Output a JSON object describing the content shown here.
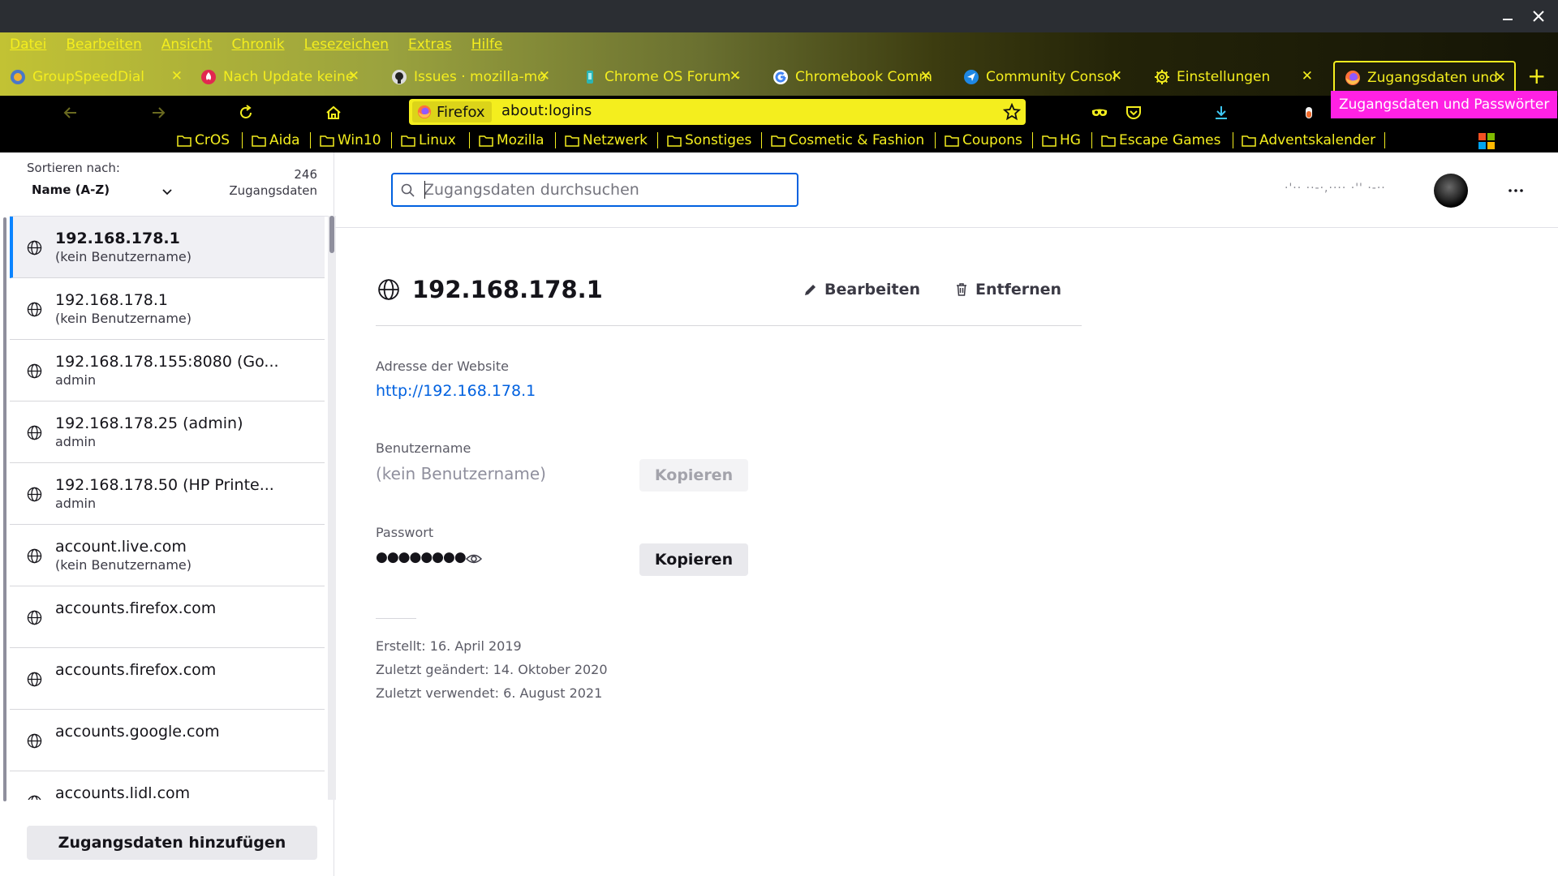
{
  "colors": {
    "accent_yellow": "#f4ee1e",
    "tooltip_magenta": "#ff21e4",
    "link_blue": "#0061e0",
    "selection_blue": "#0a84ff"
  },
  "menubar": [
    "Datei",
    "Bearbeiten",
    "Ansicht",
    "Chronik",
    "Lesezeichen",
    "Extras",
    "Hilfe"
  ],
  "tabs": [
    {
      "title": "GroupSpeedDial",
      "icon": "speed-dial-icon"
    },
    {
      "title": "Nach Update keine",
      "icon": "mozilla-support-icon"
    },
    {
      "title": "Issues · mozilla-mo",
      "icon": "github-icon"
    },
    {
      "title": "Chrome OS Forum -",
      "icon": "forum-icon"
    },
    {
      "title": "Chromebook Comm",
      "icon": "google-icon"
    },
    {
      "title": "Community Consol",
      "icon": "community-console-icon"
    },
    {
      "title": "Einstellungen",
      "icon": "gear-icon"
    },
    {
      "title": "Zugangsdaten und",
      "icon": "firefox-icon",
      "active": true
    }
  ],
  "urlbar": {
    "identity": "Firefox",
    "url": "about:logins"
  },
  "tooltip": "Zugangsdaten und Passwörter",
  "bookmarks": [
    "CrOS",
    "Aida",
    "Win10",
    "Linux",
    "Mozilla",
    "Netzwerk",
    "Sonstiges",
    "Cosmetic & Fashion",
    "Coupons",
    "HG",
    "Escape Games",
    "Adventskalender"
  ],
  "sidebar": {
    "sort_label": "Sortieren nach:",
    "sort_value": "Name (A-Z)",
    "count": "246",
    "count_label": "Zugangsdaten",
    "items": [
      {
        "origin": "192.168.178.1",
        "user": "(kein Benutzername)",
        "selected": true
      },
      {
        "origin": "192.168.178.1",
        "user": "(kein Benutzername)"
      },
      {
        "origin": "192.168.178.155:8080 (Go...",
        "user": "admin"
      },
      {
        "origin": "192.168.178.25 (admin)",
        "user": "admin"
      },
      {
        "origin": "192.168.178.50 (HP Printe...",
        "user": "admin"
      },
      {
        "origin": "account.live.com",
        "user": "(kein Benutzername)"
      },
      {
        "origin": "accounts.firefox.com",
        "user": ""
      },
      {
        "origin": "accounts.firefox.com",
        "user": ""
      },
      {
        "origin": "accounts.google.com",
        "user": ""
      },
      {
        "origin": "accounts.lidl.com",
        "user": ""
      }
    ],
    "add_button": "Zugangsdaten hinzufügen"
  },
  "header": {
    "search_placeholder": "Zugangsdaten durchsuchen",
    "account_email": "·'·· ··-·,···· ·''  ·-··"
  },
  "detail": {
    "title": "192.168.178.1",
    "edit": "Bearbeiten",
    "remove": "Entfernen",
    "site_label": "Adresse der Website",
    "site_url": "http://192.168.178.1",
    "username_label": "Benutzername",
    "username_value": "(kein Benutzername)",
    "copy_label": "Kopieren",
    "password_label": "Passwort",
    "password_value": "●●●●●●●●",
    "created": "Erstellt: 16. April 2019",
    "changed": "Zuletzt geändert: 14. Oktober 2020",
    "used": "Zuletzt verwendet: 6. August 2021"
  }
}
